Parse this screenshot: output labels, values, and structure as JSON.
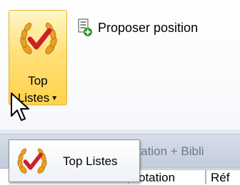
{
  "ribbon": {
    "top_lists_button": {
      "line1": "Top",
      "line2": "Listes",
      "icon": "laurel-checkmark-icon"
    },
    "propose_position_button": {
      "label": "Proposer position",
      "icon": "document-plus-icon"
    }
  },
  "background_bar": {
    "text": "otation + Bibli"
  },
  "tabs": [
    {
      "label": "otation"
    },
    {
      "label": "Réf"
    }
  ],
  "tooltip": {
    "title": "Top Listes",
    "icon": "laurel-checkmark-icon"
  },
  "colors": {
    "button_highlight": "#ffd24a",
    "laurel_gold": "#e8a020",
    "check_red": "#cc1f2a"
  }
}
